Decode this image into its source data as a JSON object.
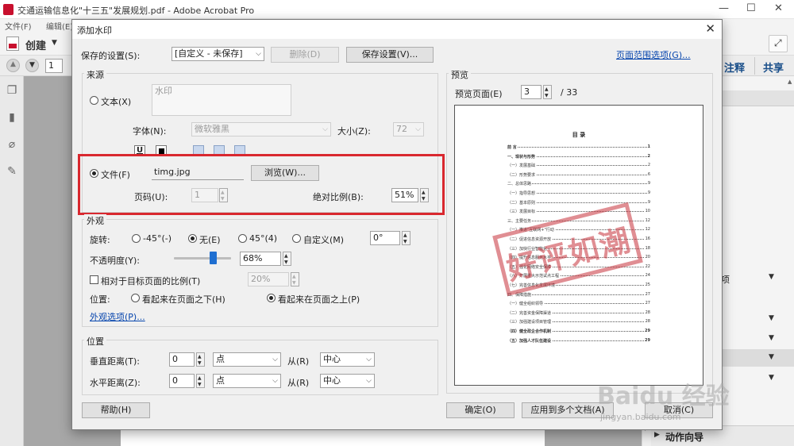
{
  "app": {
    "window_title": "交通运输信息化\"十三五\"发展规划.pdf - Adobe Acrobat Pro",
    "menu": [
      "文件(F)",
      "编辑(E)"
    ],
    "create_label": "创建",
    "page_number": "1",
    "comment_tab": "注释",
    "share_tab": "共享",
    "right_items": [
      "项"
    ],
    "action_wizard": "动作向导"
  },
  "dialog": {
    "title": "添加水印",
    "saved_settings_label": "保存的设置(S):",
    "saved_settings_value": "[自定义 - 未保存]",
    "delete_button": "删除(D)",
    "save_settings_button": "保存设置(V)...",
    "page_range_link": "页面范围选项(G)...",
    "source": {
      "group_title": "来源",
      "text_radio": "文本(X)",
      "text_value": "水印",
      "font_label": "字体(N):",
      "font_value": "微软雅黑",
      "size_label": "大小(Z):",
      "size_value": "72",
      "underline_label": "U",
      "file_radio": "文件(F)",
      "file_value": "timg.jpg",
      "browse_button": "浏览(W)...",
      "page_num_label": "页码(U):",
      "page_num_value": "1",
      "abs_scale_label": "绝对比例(B):",
      "abs_scale_value": "51%"
    },
    "appearance": {
      "group_title": "外观",
      "rotation_label": "旋转:",
      "rot_neg45": "-45°(-)",
      "rot_none": "无(E)",
      "rot_45": "45°(4)",
      "rot_custom": "自定义(M)",
      "rot_custom_value": "0°",
      "opacity_label": "不透明度(Y):",
      "opacity_value": "68%",
      "opacity_fraction": 0.68,
      "relative_scale_label": "相对于目标页面的比例(T)",
      "relative_scale_value": "20%",
      "position_label": "位置:",
      "behind_page": "看起来在页面之下(H)",
      "on_top": "看起来在页面之上(P)",
      "appearance_options_link": "外观选项(P)..."
    },
    "position": {
      "group_title": "位置",
      "vertical_label": "垂直距离(T):",
      "vertical_value": "0",
      "vertical_unit": "点",
      "vertical_from_label": "从(R)",
      "vertical_from_value": "中心",
      "horizontal_label": "水平距离(Z):",
      "horizontal_value": "0",
      "horizontal_unit": "点",
      "horizontal_from_label": "从(R)",
      "horizontal_from_value": "中心"
    },
    "preview": {
      "group_title": "预览",
      "preview_page_label": "预览页面(E)",
      "preview_page_value": "3",
      "total_pages": "/ 33",
      "doc_heading": "目  录",
      "stamp_text": "好评如潮",
      "toc": [
        {
          "t": "前    言",
          "n": "1",
          "bold": true
        },
        {
          "t": "一、现状与形势",
          "n": "2",
          "bold": true
        },
        {
          "t": "（一）发展基础",
          "n": "2",
          "bold": false
        },
        {
          "t": "（二）形势要求",
          "n": "6",
          "bold": false
        },
        {
          "t": "二、总体思路",
          "n": "9",
          "bold": false
        },
        {
          "t": "（一）指导思想",
          "n": "9",
          "bold": false
        },
        {
          "t": "（二）基本原则",
          "n": "9",
          "bold": false
        },
        {
          "t": "（三）发展目标",
          "n": "10",
          "bold": false
        },
        {
          "t": "三、主要任务",
          "n": "12",
          "bold": false
        },
        {
          "t": "（一）推进\"互联网+\"行动",
          "n": "12",
          "bold": false
        },
        {
          "t": "（二）促进信息资源开放",
          "n": "16",
          "bold": false
        },
        {
          "t": "（三）加快行业智能化",
          "n": "18",
          "bold": false
        },
        {
          "t": "（四）提升信息服务水平",
          "n": "20",
          "bold": false
        },
        {
          "t": "（五）强化网络安全保障",
          "n": "22",
          "bold": false
        },
        {
          "t": "（六）开展重大示范试点工程",
          "n": "24",
          "bold": false
        },
        {
          "t": "（七）完善信息化发展环境",
          "n": "25",
          "bold": false
        },
        {
          "t": "四、保障措施",
          "n": "27",
          "bold": false
        },
        {
          "t": "（一）健全组织领导",
          "n": "27",
          "bold": false
        },
        {
          "t": "（二）完善资金保障渠道",
          "n": "28",
          "bold": false
        },
        {
          "t": "（三）加强建设项目管理",
          "n": "28",
          "bold": false
        },
        {
          "t": "（四）健全政企合作机制",
          "n": "29",
          "bold": true
        },
        {
          "t": "（五）加强人才队伍建设",
          "n": "29",
          "bold": true
        }
      ]
    },
    "help_button": "帮助(H)",
    "ok_button": "确定(O)",
    "apply_multiple_button": "应用到多个文档(A)",
    "cancel_button": "取消(C)"
  },
  "watermark_site": "Baidu 经验",
  "watermark_url": "jingyan.baidu.com"
}
